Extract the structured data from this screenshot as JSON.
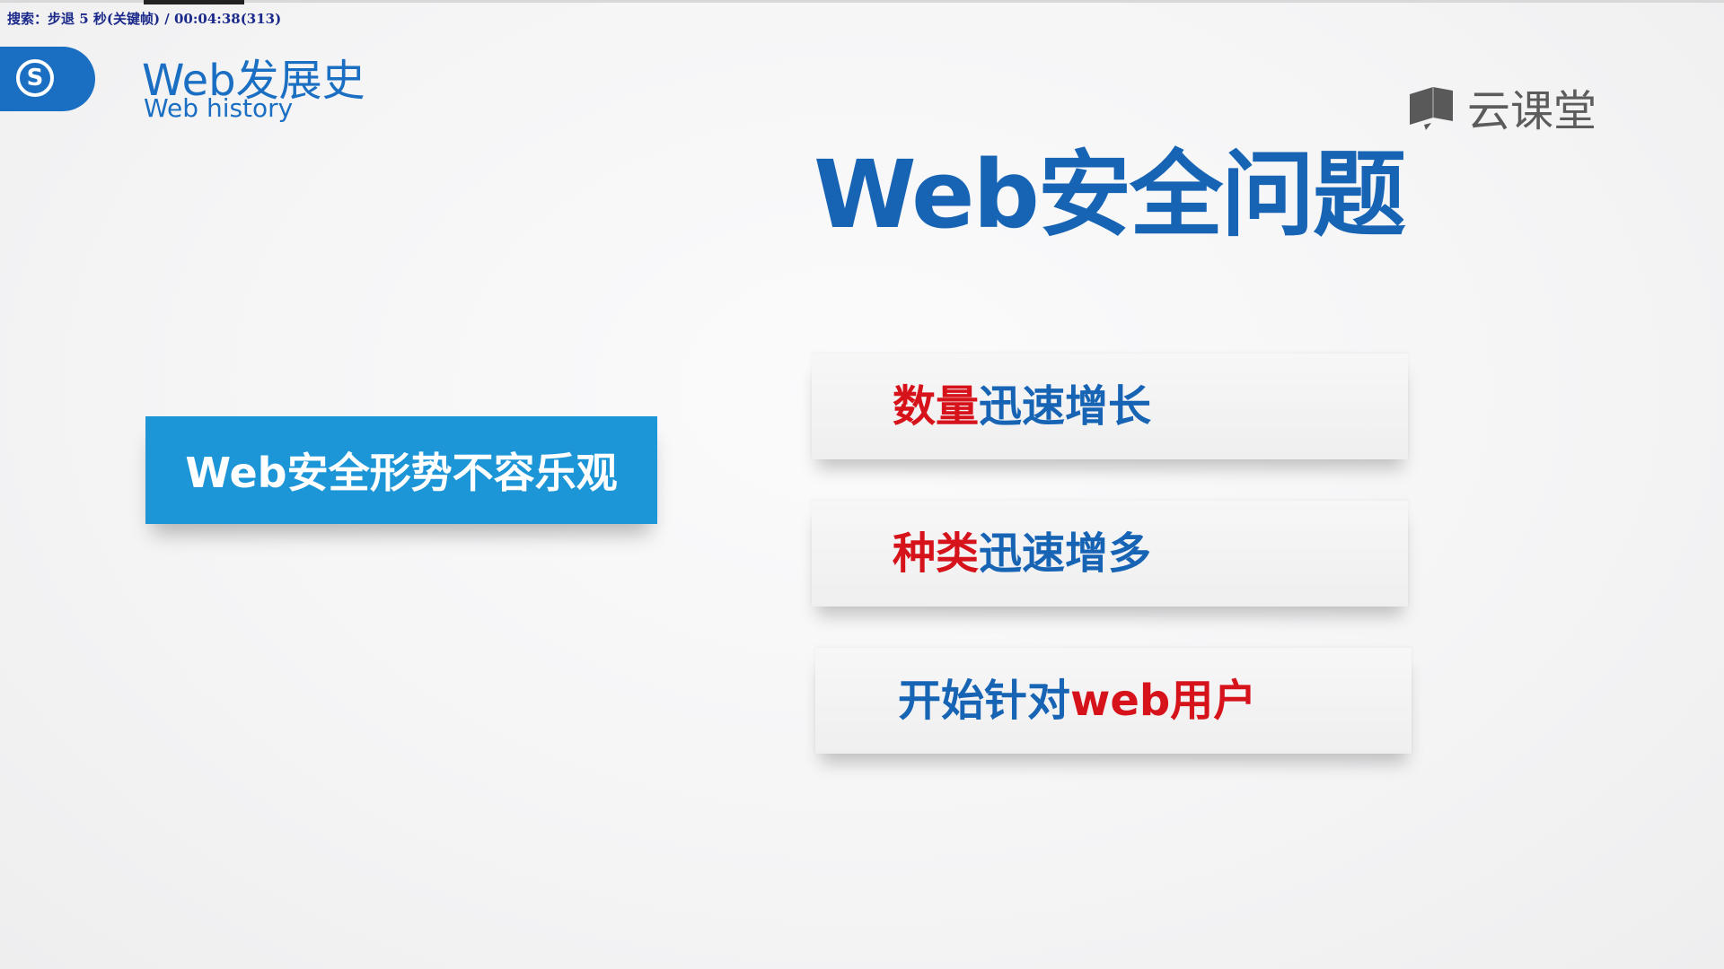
{
  "osd": {
    "text": "搜索：步退 5 秒(关键帧) / 00:04:38(313)"
  },
  "header": {
    "logo_letter": "S",
    "title": "Web发展史",
    "subtitle": "Web history"
  },
  "brand": {
    "icon": "book-icon",
    "name": "云课堂"
  },
  "slide": {
    "title": "Web安全问题",
    "callout": "Web安全形势不容乐观",
    "items": [
      {
        "red": "数量",
        "blue": "迅速增长"
      },
      {
        "red": "种类",
        "blue": "迅速增多"
      },
      {
        "blue": "开始针对",
        "red": "web用户"
      }
    ]
  },
  "colors": {
    "accent_blue": "#1764b5",
    "callout_blue": "#1d96d8",
    "highlight_red": "#d6131b"
  }
}
